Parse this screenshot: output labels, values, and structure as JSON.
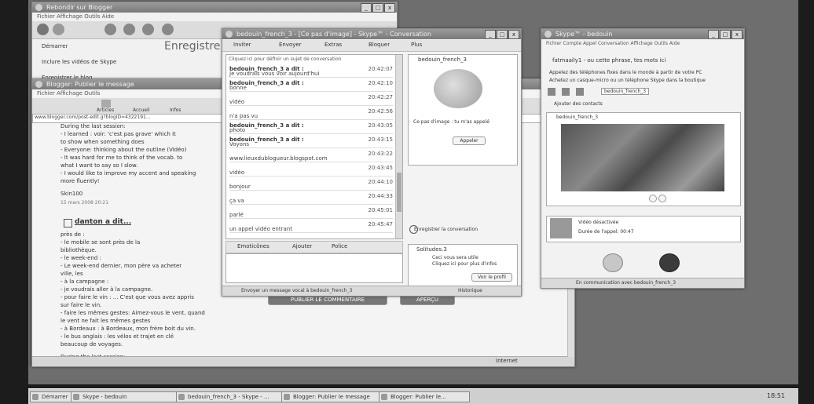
{
  "blogger": {
    "title": "Rebondir sur Blogger",
    "menu": "Fichier Affichage Outils Aide",
    "header": "Enregistre",
    "side_items": [
      "Démarrer",
      "Inclure les vidéos de Skype",
      "Enregistrer le blog"
    ],
    "url": "www.blogger.com/post-edit.g?blogID=4322191...",
    "post_lines": [
      "During the last session:",
      "- I learned : voir: 'c'est pas grave' which it",
      "  to show when something does",
      "- Everyone: thinking about the outline (Vidéo)",
      "- It was hard for me to think of the vocab. to",
      "  what I want to say so I slow.",
      "- I would like to improve my accent and speaking",
      "  more fluently!"
    ],
    "signature": "Skin100",
    "date": "15 mars 2008 20:21",
    "comment_author": "danton a dit...",
    "comment_lines": [
      "près de :",
      "- le mobile se sont près de la",
      "  bibliothèque.",
      "- le week-end :",
      "- Le week-end dernier, mon père va acheter",
      "  ville, les",
      "- à la campagne :",
      "- je voudrais aller à la campagne.",
      "- pour faire le vin : ... C'est que vous avez appris",
      "  sur faire le vin.",
      "- faire les mêmes gestes: Aimez-vous le vent, quand",
      "  le vent ne fait les mêmes gestes",
      "- à Bordeaux : à Bordeaux, mon frère boit du vin.",
      "- le bus anglais : les vélos et trajet en clé",
      "  beaucoup de voyages."
    ],
    "footer_line": "During the last session:",
    "buttons": [
      "PUBLIER LE COMMENTAIRE",
      "APERÇU"
    ],
    "status": "Internet"
  },
  "browser2": {
    "title": "Blogger: Publier le message",
    "tabs": [
      "Articles",
      "Accueil",
      "Infos"
    ],
    "menu": "Fichier Affichage Outils"
  },
  "chat": {
    "title": "bedouin_french_3 - [Ce pas d'image] - Skype™ - Conversation",
    "toolbar": [
      "Inviter",
      "Envoyer",
      "Extras",
      "Bloquer",
      "Plus"
    ],
    "topic": "Cliquez ici pour définir un sujet de conversation",
    "messages": [
      {
        "who": "bedouin_french_3 a dit :",
        "time": "20:42:07",
        "msg": "Je voudrais vous voir aujourd'hui"
      },
      {
        "who": "bedouin_french_3 a dit :",
        "time": "20:42:10",
        "msg": "bonne"
      },
      {
        "who": "",
        "time": "20:42:27",
        "msg": "vidéo"
      },
      {
        "who": "",
        "time": "20:42:56",
        "msg": "n'a pas vu"
      },
      {
        "who": "bedouin_french_3 a dit :",
        "time": "20:43:05",
        "msg": "photo"
      },
      {
        "who": "bedouin_french_3 a dit :",
        "time": "20:43:15",
        "msg": "Voyons"
      },
      {
        "who": "",
        "time": "20:43:22",
        "msg": "www.lieuxdublogueur.blogspot.com"
      },
      {
        "who": "",
        "time": "20:43:45",
        "msg": "vidéo"
      },
      {
        "who": "",
        "time": "20:44:10",
        "msg": "bonjour"
      },
      {
        "who": "",
        "time": "20:44:33",
        "msg": "ça va"
      },
      {
        "who": "",
        "time": "20:45:01",
        "msg": "parlé"
      },
      {
        "who": "",
        "time": "20:45:47",
        "msg": "un appel vidéo entrant"
      }
    ],
    "input_bar": [
      "Emoticônes",
      "Ajouter",
      "Police"
    ],
    "contact_name": "bedouin_french_3",
    "status_text": "Ce pas d'image : tu m'as appelé",
    "call_btn": "Appeler",
    "mood_text": "Enregistrer la conversation",
    "contact2": "Solitudes.3",
    "contact2_lines": [
      "Ceci vous sera utile",
      "Cliquez ici pour plus d'infos"
    ],
    "link_btn": "Voir le profil",
    "bottom": "Envoyer un message vocal à bedouin_french_3",
    "bottom_right": "Historique"
  },
  "skype": {
    "title": "Skype™ - bedouin",
    "menu": "Fichier  Compte  Appel  Conversation  Affichage  Outils  Aide",
    "user_line": "fatmaaily1 - ou cette phrase, tes mots ici",
    "notice1": "Appelez des téléphones fixes dans le monde à partir de votre PC",
    "notice2": "Achetez un casque-micro ou un téléphone Skype dans la boutique",
    "tab_label": "bedouin_french_3",
    "find": "Ajouter des contacts",
    "video_caption": "bedouin_french_3",
    "call_name": "Vidéo désactivée",
    "call_duration": "Durée de l'appel: 00:47",
    "footer": "En communication avec bedouin_french_3"
  },
  "taskbar": {
    "start": "Démarrer",
    "tasks": [
      "Skype - bedouin",
      "bedouin_french_3 - Skype - ...",
      "Blogger: Publier le message",
      "Blogger: Publier le..."
    ],
    "clock": "18:51"
  }
}
